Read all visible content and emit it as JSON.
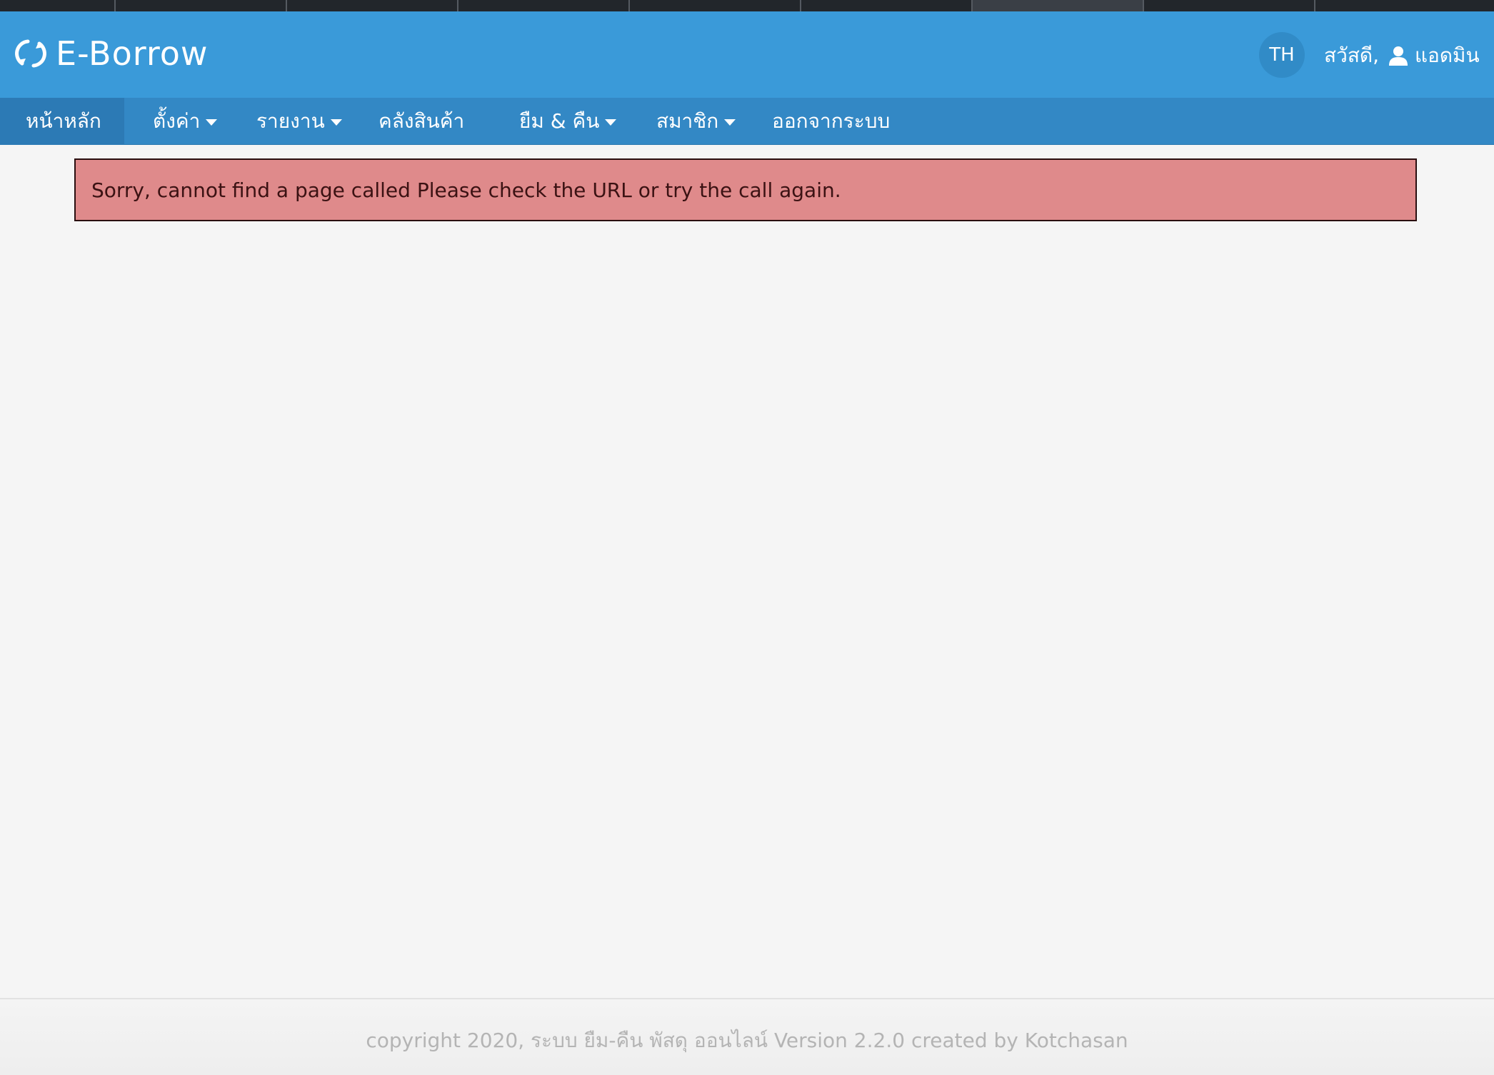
{
  "app": {
    "title": "E-Borrow"
  },
  "header": {
    "language": "TH",
    "greeting": "สวัสดี,",
    "user_name": "แอดมิน"
  },
  "nav": {
    "items": [
      {
        "label": "หน้าหลัก",
        "active": true,
        "dropdown": false
      },
      {
        "label": "ตั้งค่า",
        "active": false,
        "dropdown": true
      },
      {
        "label": "รายงาน",
        "active": false,
        "dropdown": true
      },
      {
        "label": "คลังสินค้า",
        "active": false,
        "dropdown": false
      },
      {
        "label": "ยืม & คืน",
        "active": false,
        "dropdown": true
      },
      {
        "label": "สมาชิก",
        "active": false,
        "dropdown": true
      },
      {
        "label": "ออกจากระบบ",
        "active": false,
        "dropdown": false
      }
    ]
  },
  "alert": {
    "message": "Sorry, cannot find a page called Please check the URL or try the call again."
  },
  "footer": {
    "text": "copyright 2020, ระบบ ยืม-คืน พัสดุ ออนไลน์ Version 2.2.0 created by Kotchasan"
  },
  "colors": {
    "header": "#3a9ad9",
    "navbar": "#3388c5",
    "alert_bg": "#df8a8b",
    "page_bg": "#f5f5f5"
  }
}
